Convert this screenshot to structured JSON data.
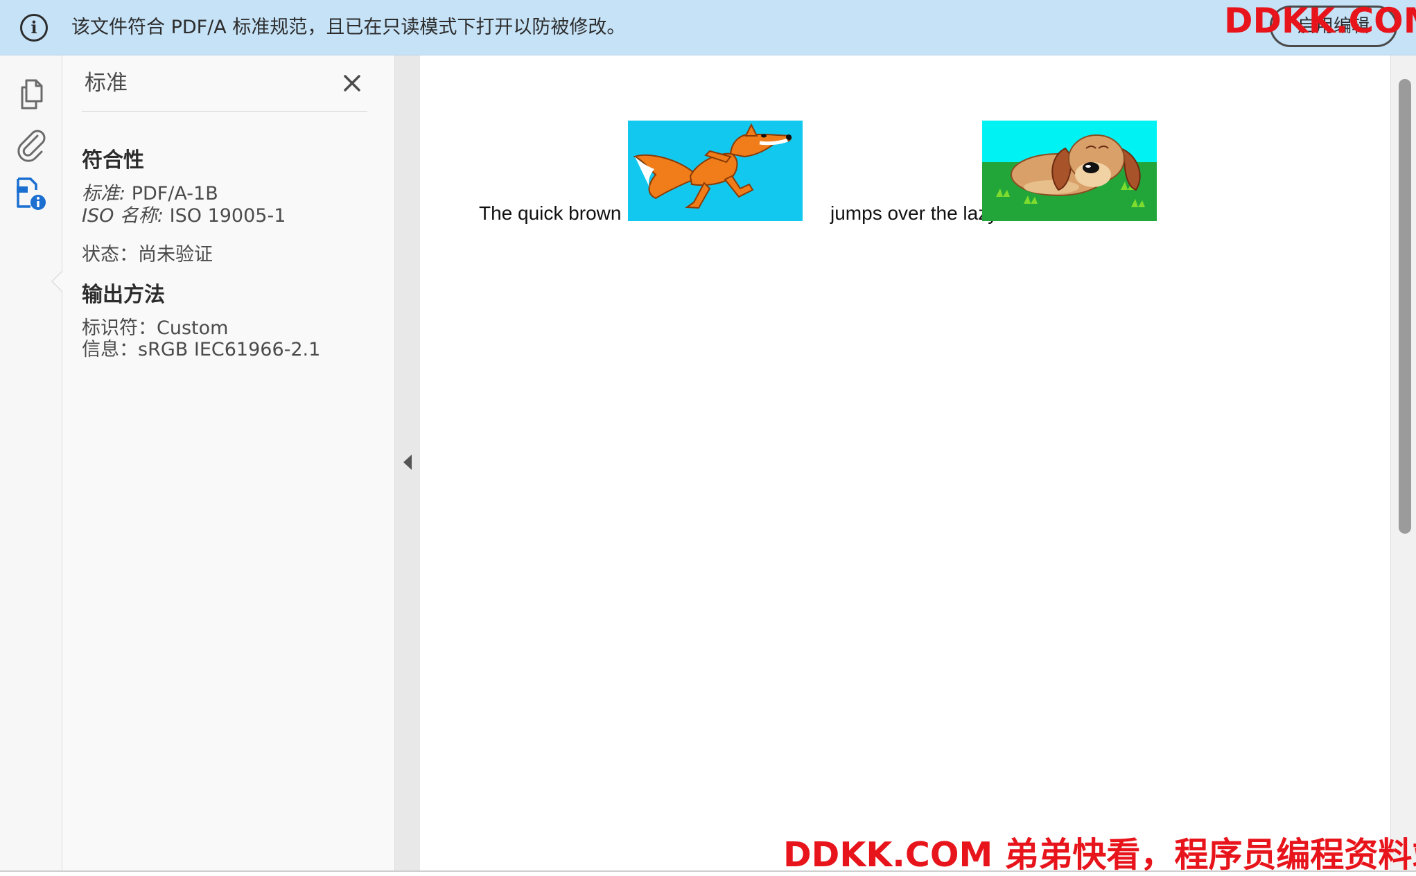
{
  "banner": {
    "text": "该文件符合 PDF/A 标准规范，且已在只读模式下打开以防被修改。",
    "enable_edit_label": "启用编辑",
    "icon": "info-icon"
  },
  "watermark": {
    "top": "DDKK.COM",
    "bottom": "DDKK.COM 弟弟快看，程序员编程资料站",
    "color": "#e8141b"
  },
  "toolrail": {
    "tools": [
      {
        "name": "pages",
        "icon": "copy-pages-icon"
      },
      {
        "name": "attachments",
        "icon": "paperclip-icon"
      },
      {
        "name": "standards",
        "icon": "standards-info-icon",
        "selected": true
      }
    ]
  },
  "panel": {
    "title": "标准",
    "conformance": {
      "heading": "符合性",
      "standard_key": "标准:",
      "standard_value": "PDF/A-1B",
      "iso_key": "ISO 名称:",
      "iso_value": "ISO 19005-1",
      "status": "状态：尚未验证"
    },
    "output_intent": {
      "heading": "输出方法",
      "identifier": "标识符：Custom",
      "info": "信息：sRGB IEC61966-2.1"
    }
  },
  "document": {
    "text1": "The quick brown",
    "text2": "jumps over the lazy",
    "image1": "fox-image",
    "image2": "dog-image"
  },
  "colors": {
    "banner_bg": "#c6e2f7",
    "accent_blue": "#1a6fd0",
    "fox_bg": "#12c8ee",
    "dog_bg_sky": "#00f2f2",
    "dog_bg_grass": "#22a63a"
  }
}
